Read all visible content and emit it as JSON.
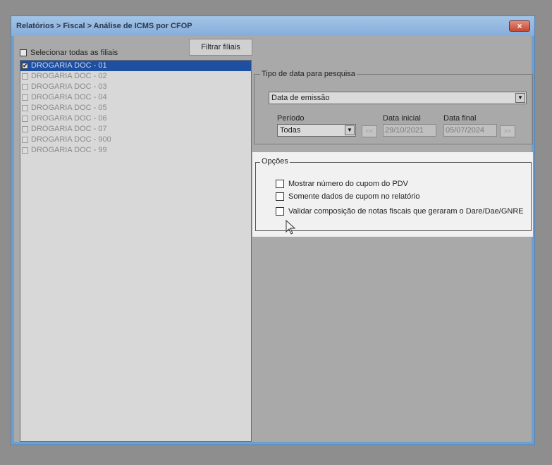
{
  "window": {
    "title": "Relatórios > Fiscal > Análise de ICMS por CFOP",
    "close_symbol": "×"
  },
  "branches": {
    "select_all_label": "Selecionar todas as filiais",
    "filter_button": "Filtrar filiais",
    "items": [
      {
        "label": "DROGARIA DOC - 01",
        "checked": true,
        "selected": true
      },
      {
        "label": "DROGARIA DOC - 02",
        "checked": false,
        "selected": false
      },
      {
        "label": "DROGARIA DOC - 03",
        "checked": false,
        "selected": false
      },
      {
        "label": "DROGARIA DOC - 04",
        "checked": false,
        "selected": false
      },
      {
        "label": "DROGARIA DOC - 05",
        "checked": false,
        "selected": false
      },
      {
        "label": "DROGARIA DOC - 06",
        "checked": false,
        "selected": false
      },
      {
        "label": "DROGARIA DOC - 07",
        "checked": false,
        "selected": false
      },
      {
        "label": "DROGARIA DOC - 900",
        "checked": false,
        "selected": false
      },
      {
        "label": "DROGARIA DOC - 99",
        "checked": false,
        "selected": false
      }
    ]
  },
  "date_search": {
    "legend": "Tipo de data para pesquisa",
    "date_type_value": "Data de emissão",
    "period_label": "Período",
    "period_value": "Todas",
    "prev_button": "<<",
    "next_button": ">>",
    "start_label": "Data inicial",
    "start_value": "29/10/2021",
    "end_label": "Data final",
    "end_value": "05/07/2024"
  },
  "options": {
    "legend": "Opções",
    "items": [
      {
        "label": "Mostrar número do cupom do PDV",
        "checked": false
      },
      {
        "label": "Somente dados de cupom no relatório",
        "checked": false
      },
      {
        "label": "Validar composição de notas fiscais  que geraram o Dare/Dae/GNRE",
        "checked": false
      }
    ]
  },
  "colors": {
    "selection": "#1f4fa0",
    "options_highlight": "#f1f1f1",
    "window_frame": "#6e9fcf"
  }
}
